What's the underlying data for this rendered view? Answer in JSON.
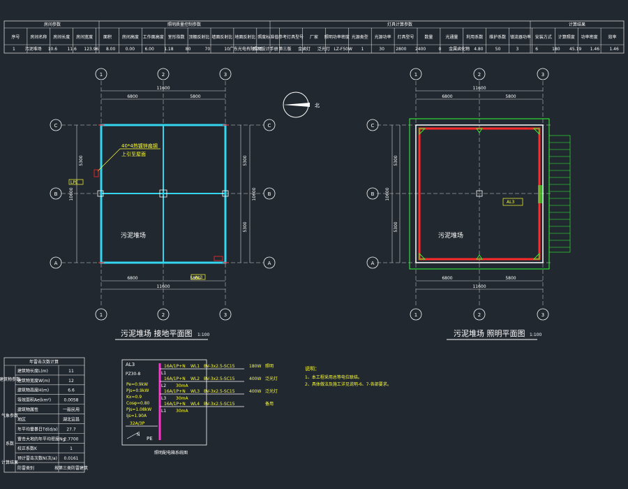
{
  "top_table": {
    "group_headers": [
      "房间参数",
      "照明质量控制参数",
      "灯具计算参数",
      "计算结果"
    ],
    "columns": [
      "序号",
      "房间名称",
      "房间长度",
      "房间宽度",
      "面积",
      "房间高度",
      "工作面高度",
      "室形指数",
      "顶棚反射比",
      "墙面反射比",
      "地面反射比",
      "照度标准值",
      "参考灯具型号",
      "厂家",
      "照明功率密度",
      "光源类型",
      "光源功率",
      "灯具型号",
      "数量",
      "光通量",
      "利用系数",
      "维护系数",
      "镇流器功率",
      "安装方式",
      "计算照度",
      "功率密度",
      "效率"
    ],
    "units": [
      "(m)",
      "(m)",
      "(m²)",
      "(m)",
      "(m)",
      "(W)",
      "(lm)",
      "(lx)",
      "(W/m²)"
    ],
    "row": [
      "1",
      "污泥堆场",
      "10.6",
      "11.6",
      "123.96",
      "8.00",
      "0.00",
      "6.00",
      "1.18",
      "80",
      "70",
      "10",
      "广东光电有限公司",
      "照明设计手册",
      "第三版",
      "金卤灯",
      "泛光灯",
      "LZ-F50W",
      "1",
      "30",
      "2800",
      "2400",
      "0",
      "金属卤化物",
      "4.80",
      "50",
      "3",
      "6",
      "180",
      "45.19",
      "1.46",
      "1.46"
    ]
  },
  "north_label": "北",
  "left_plan": {
    "title": "污泥堆场 接地平面图",
    "scale": "1:100",
    "room_label": "污泥堆场",
    "annotation_1": "40*4热镀锌扁钢",
    "annotation_2": "上引至屋面",
    "tag_left": "LPE",
    "tag_bottom": "AL3",
    "top_dim_total": "11600",
    "top_dim_a": "6800",
    "top_dim_b": "5800",
    "bottom_dim_a": "6800",
    "bottom_dim_b": "5800",
    "bottom_dim_total": "11600",
    "side_dim_total": "10600",
    "side_dim_a": "5300",
    "side_dim_b": "5300"
  },
  "right_plan": {
    "title": "污泥堆场 照明平面图",
    "scale": "1:100",
    "room_label": "污泥堆场",
    "tag": "AL3",
    "top_dim_total": "11600",
    "top_dim_a": "6800",
    "top_dim_b": "5800",
    "bottom_dim_a": "6800",
    "bottom_dim_b": "5800",
    "bottom_dim_total": "11600",
    "side_dim_total": "10600",
    "side_dim_a": "5300",
    "side_dim_b": "5300"
  },
  "axes": {
    "cols": [
      "1",
      "2",
      "3"
    ],
    "rows": [
      "C",
      "B",
      "A"
    ]
  },
  "calc_table": {
    "header": "年雷击次数计算",
    "rows": [
      [
        "建筑物长度L(m)",
        "11"
      ],
      [
        "建筑物宽度W(m)",
        "12"
      ],
      [
        "建筑物高度H(m)",
        "6.6"
      ],
      [
        "等效面积Ae(km²)",
        "0.0058"
      ],
      [
        "建筑物属性",
        "一般民用"
      ],
      [
        "地区",
        "湖北宜昌"
      ],
      [
        "年平均雷暴日Td(d/a)",
        "27.7"
      ],
      [
        "雷击大地的年平均密度Ng",
        "2.7700"
      ],
      [
        "校正系数K",
        "1"
      ],
      [
        "预计雷击次数N(次/a)",
        "0.0161"
      ],
      [
        "防雷类别",
        "按第三类防雷建筑"
      ]
    ],
    "side_labels": [
      "建筑物参数",
      "气象参数",
      "系数",
      "计算结果"
    ]
  },
  "panel": {
    "name": "AL3",
    "model": "PZ30-8",
    "params": [
      "Pe=0.9kW",
      "Pjs=0.9kW",
      "Kx=0.9",
      "Cosφ=0.80",
      "Pjs=1.08kW",
      "Ijs=1.90A"
    ],
    "incoming": "32A/3P",
    "n_label": "N",
    "pe_label": "PE",
    "circuits": [
      {
        "breaker": "16A/1P+N",
        "phase": "L1",
        "id": "WL1",
        "cable": "BV-3x2.5-SC15",
        "load": "180W",
        "desc": "照明"
      },
      {
        "breaker": "16A/1P+N",
        "phase": "L2",
        "id": "WL2",
        "cable": "BV-3x2.5-SC15",
        "load": "400W",
        "desc": "泛光灯"
      },
      {
        "breaker": "16A/1P+N",
        "phase": "L3",
        "id": "WL3",
        "cable": "BV-3x2.5-SC15",
        "load": "400W",
        "desc": "泛光灯"
      },
      {
        "breaker": "16A/1P+N",
        "phase": "L1",
        "id": "WL4",
        "cable": "BV-3x2.5-SC15",
        "load": "",
        "desc": "备用"
      }
    ],
    "rcd": "30mA",
    "caption": "照明配电箱系统图"
  },
  "notes": {
    "title": "说明：",
    "lines": [
      "1、本工程采用总等电位联结。",
      "2、具体做法及施工详见说明-6、7-各部要求。"
    ]
  },
  "colors": {
    "background": "#212830",
    "grid": "#d8d8d8",
    "wall_cyan": "#34d5ee",
    "light_red": "#ff2a2a",
    "outline_green": "#33ff33",
    "annotation_yellow": "#ffff33",
    "panel_magenta": "#ff33cc"
  }
}
